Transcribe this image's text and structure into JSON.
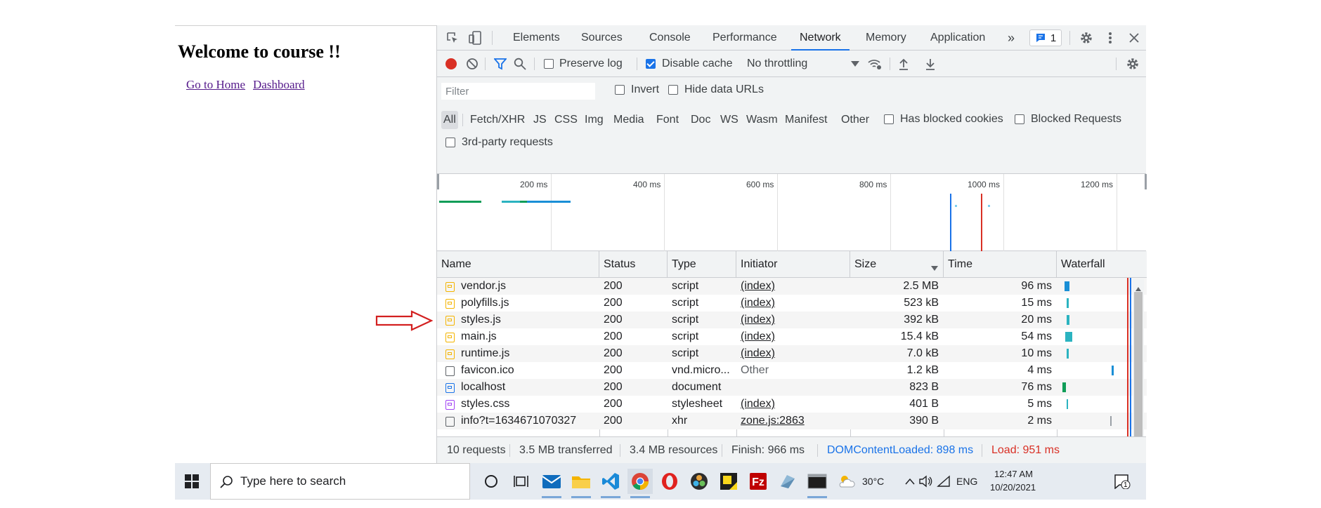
{
  "page": {
    "heading": "Welcome to course !!",
    "links": [
      "Go to Home",
      "Dashboard"
    ]
  },
  "devtools": {
    "tabs": [
      "Elements",
      "Sources",
      "Console",
      "Performance",
      "Network",
      "Memory",
      "Application"
    ],
    "active_tab": "Network",
    "issues_count": "1",
    "toolbar": {
      "preserve_log": "Preserve log",
      "disable_cache": "Disable cache",
      "throttling": "No throttling"
    },
    "filter": {
      "placeholder": "Filter",
      "invert": "Invert",
      "hide_data_urls": "Hide data URLs",
      "types": [
        "All",
        "Fetch/XHR",
        "JS",
        "CSS",
        "Img",
        "Media",
        "Font",
        "Doc",
        "WS",
        "Wasm",
        "Manifest",
        "Other"
      ],
      "has_blocked_cookies": "Has blocked cookies",
      "blocked_requests": "Blocked Requests",
      "third_party": "3rd-party requests"
    },
    "overview_ticks": [
      "200 ms",
      "400 ms",
      "600 ms",
      "800 ms",
      "1000 ms",
      "1200 ms"
    ],
    "columns": [
      "Name",
      "Status",
      "Type",
      "Initiator",
      "Size",
      "Time",
      "Waterfall"
    ],
    "rows": [
      {
        "name": "vendor.js",
        "status": "200",
        "type": "script",
        "initiator": "(index)",
        "size": "2.5 MB",
        "time": "96 ms",
        "icon": "script-icon"
      },
      {
        "name": "polyfills.js",
        "status": "200",
        "type": "script",
        "initiator": "(index)",
        "size": "523 kB",
        "time": "15 ms",
        "icon": "script-icon"
      },
      {
        "name": "styles.js",
        "status": "200",
        "type": "script",
        "initiator": "(index)",
        "size": "392 kB",
        "time": "20 ms",
        "icon": "script-icon"
      },
      {
        "name": "main.js",
        "status": "200",
        "type": "script",
        "initiator": "(index)",
        "size": "15.4 kB",
        "time": "54 ms",
        "icon": "script-icon"
      },
      {
        "name": "runtime.js",
        "status": "200",
        "type": "script",
        "initiator": "(index)",
        "size": "7.0 kB",
        "time": "10 ms",
        "icon": "script-icon"
      },
      {
        "name": "favicon.ico",
        "status": "200",
        "type": "vnd.micro...",
        "initiator": "Other",
        "size": "1.2 kB",
        "time": "4 ms",
        "icon": "file-icon"
      },
      {
        "name": "localhost",
        "status": "200",
        "type": "document",
        "initiator": "",
        "size": "823 B",
        "time": "76 ms",
        "icon": "document-icon"
      },
      {
        "name": "styles.css",
        "status": "200",
        "type": "stylesheet",
        "initiator": "(index)",
        "size": "401 B",
        "time": "5 ms",
        "icon": "stylesheet-icon"
      },
      {
        "name": "info?t=1634671070327",
        "status": "200",
        "type": "xhr",
        "initiator": "zone.js:2863",
        "size": "390 B",
        "time": "2 ms",
        "icon": "file-icon"
      }
    ],
    "summary": {
      "requests": "10 requests",
      "transferred": "3.5 MB transferred",
      "resources": "3.4 MB resources",
      "finish": "Finish: 966 ms",
      "dom_content_loaded": "DOMContentLoaded: 898 ms",
      "load": "Load: 951 ms"
    },
    "colors": {
      "accent": "#1a73e8",
      "record": "#d93025",
      "dcl": "#1a73e8",
      "load": "#d93025"
    }
  },
  "taskbar": {
    "search_placeholder": "Type here to search",
    "temperature": "30°C",
    "language": "ENG",
    "time": "12:47 AM",
    "date": "10/20/2021",
    "notification_count": "1"
  }
}
